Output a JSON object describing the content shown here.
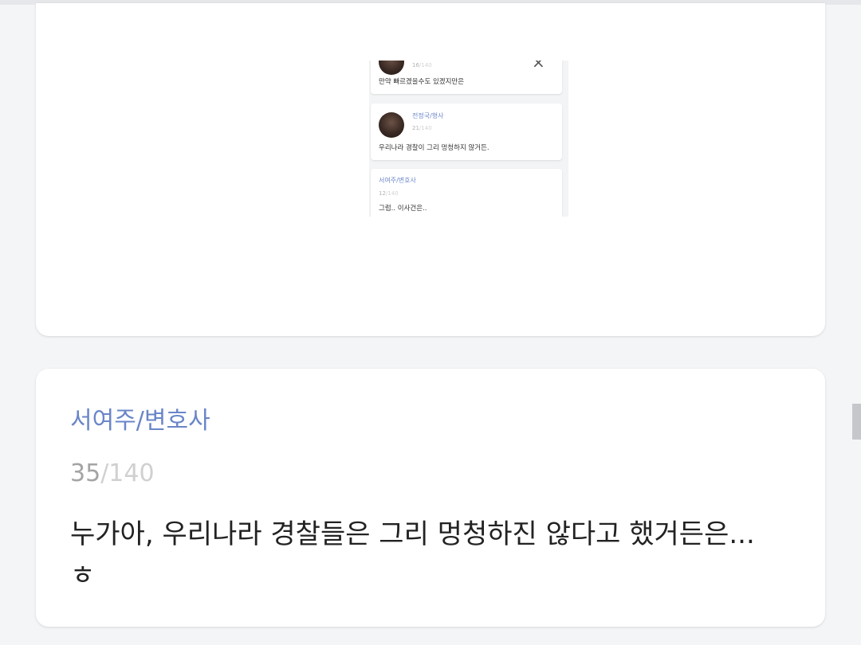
{
  "embedded_screenshot": {
    "messages": [
      {
        "count": "16",
        "total": "/140",
        "text": "만약 빠르겠을수도 있겠지만은"
      },
      {
        "name": "전정국/형사",
        "count": "21",
        "total": "/140",
        "text": "우리나라 경찰이 그리 멍청하지 않거든."
      },
      {
        "name": "서여주/변호사",
        "count": "12",
        "total": "/140",
        "text": "그럼.. 이사건은.."
      }
    ],
    "close_glyph": "×"
  },
  "message": {
    "name": "서여주/변호사",
    "count": "35",
    "total": "/140",
    "text": "누가아, 우리나라 경찰들은 그리 멍청하진 않다고 했거든은... ㅎ"
  }
}
